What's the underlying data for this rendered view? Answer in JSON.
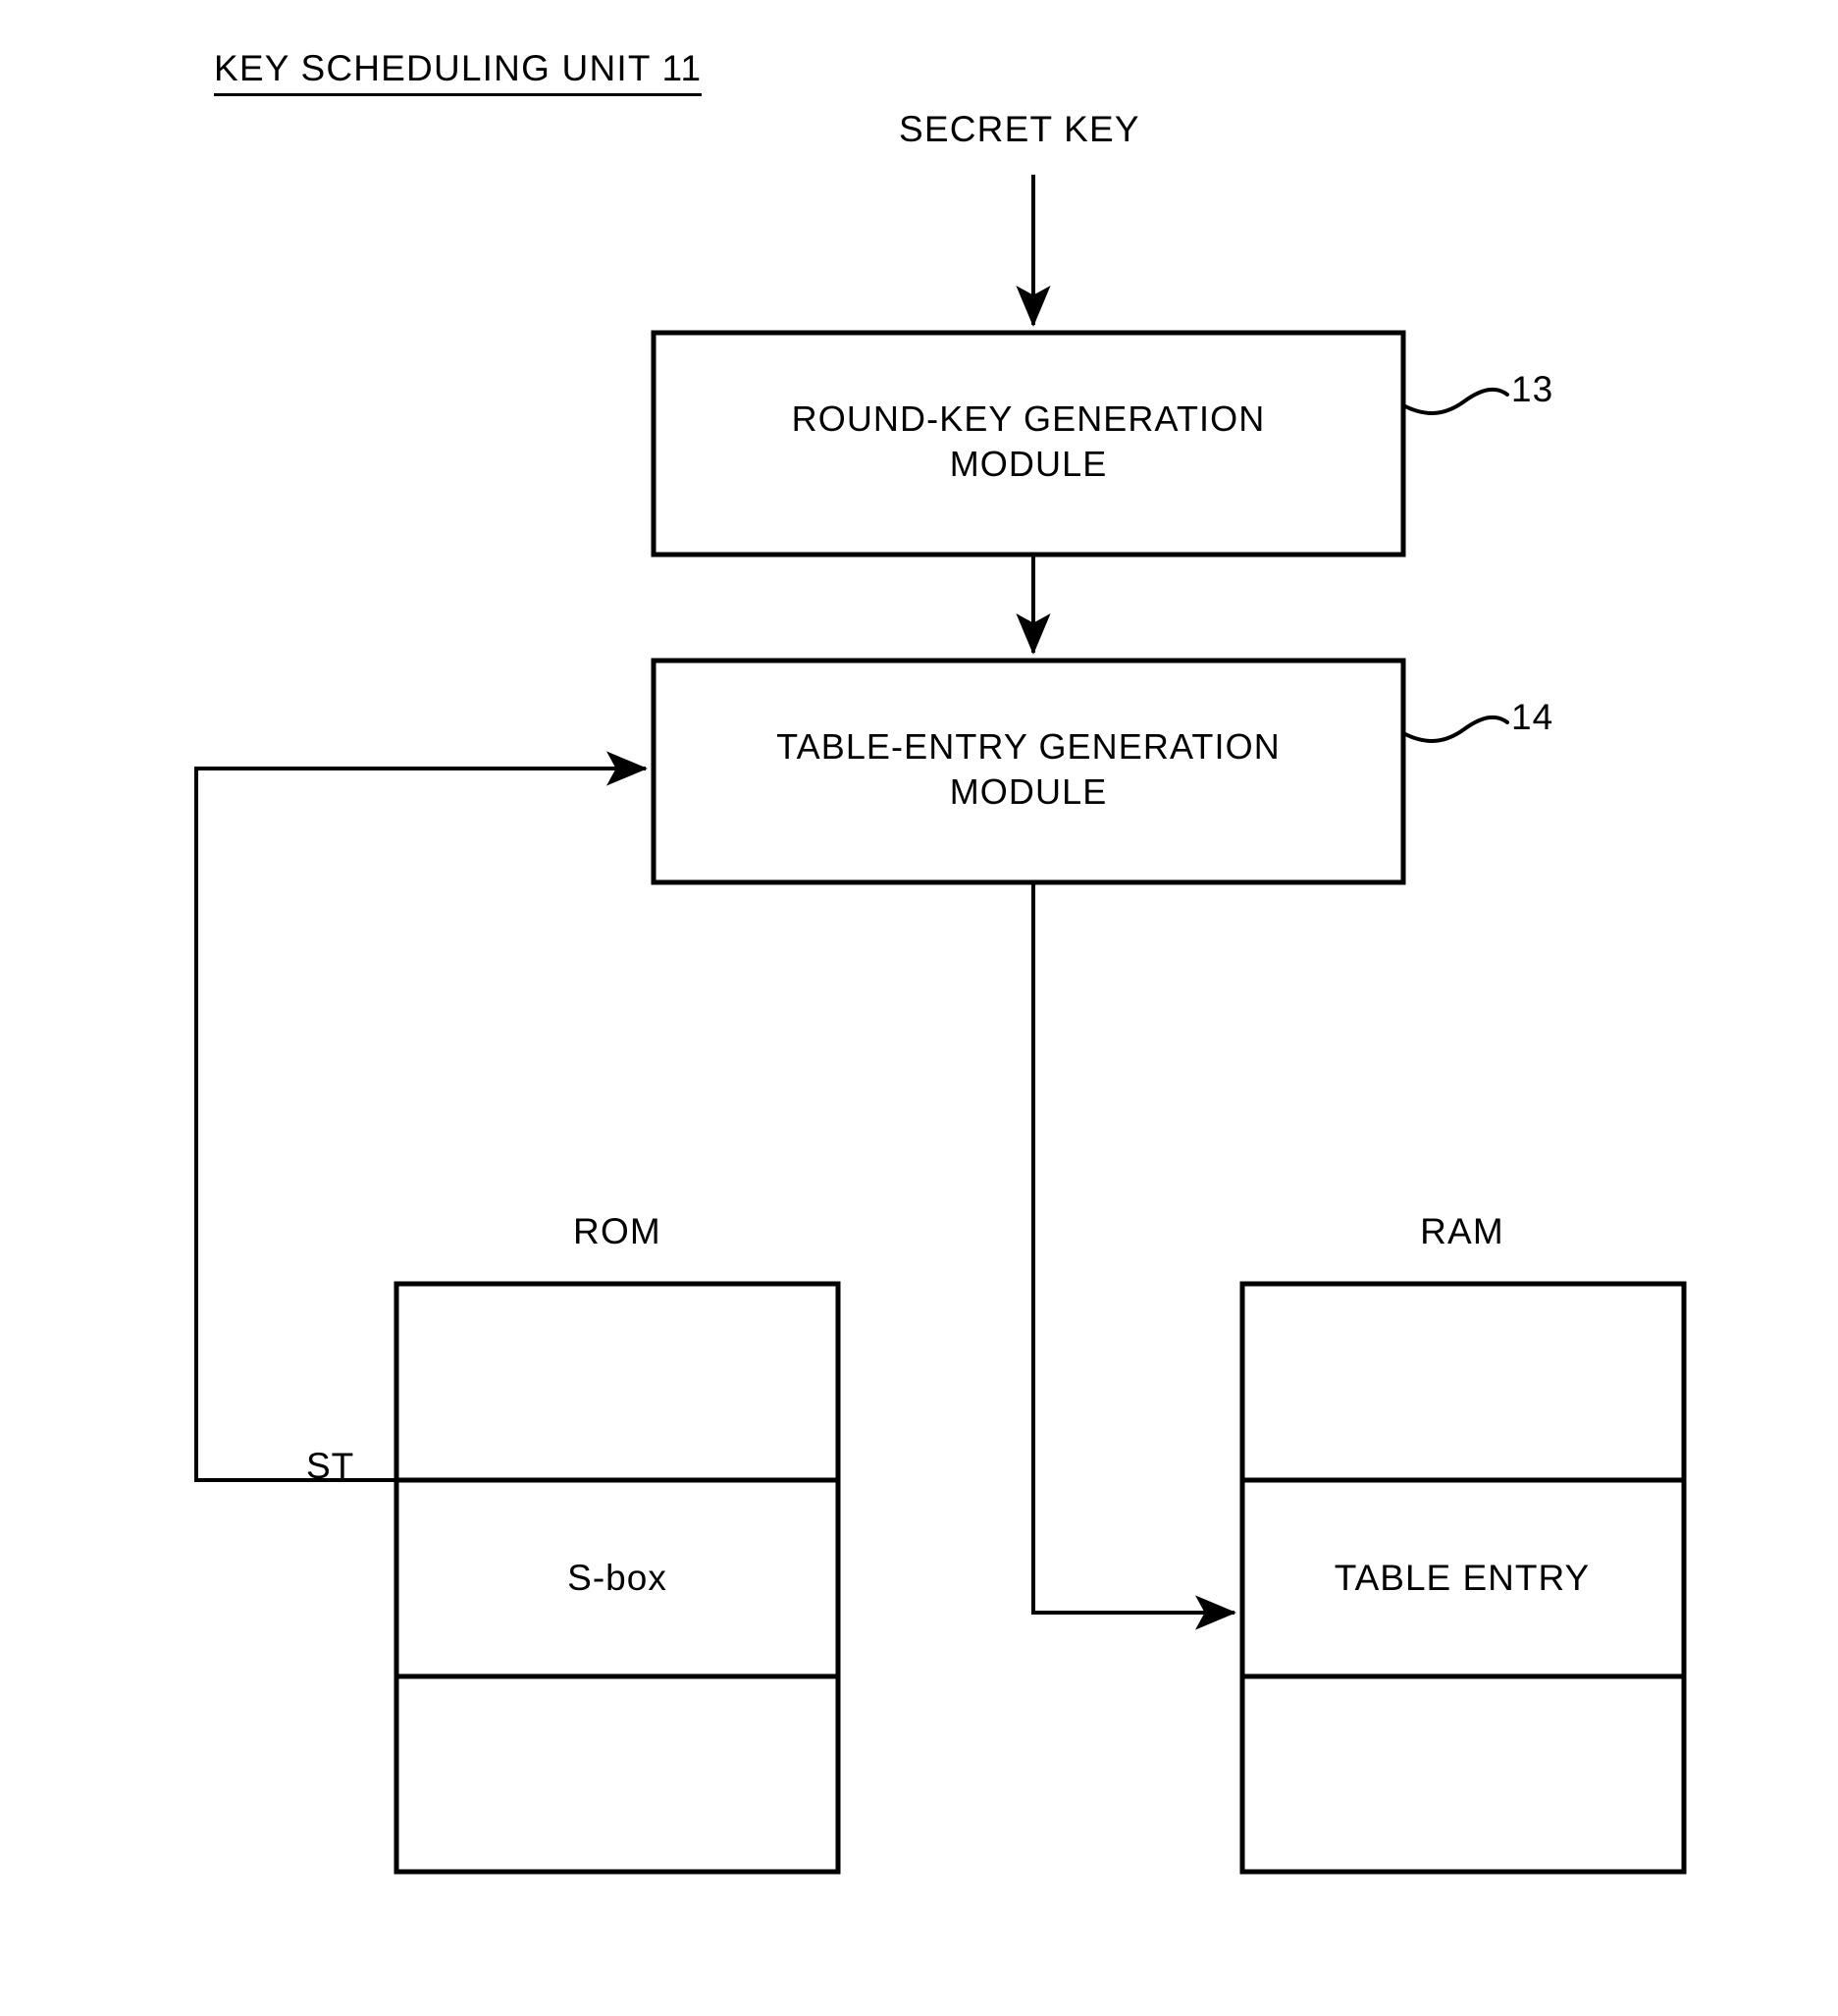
{
  "figure": {
    "title": "KEY SCHEDULING UNIT 11",
    "background_color": "#ffffff",
    "line_color": "#000000"
  },
  "labels": {
    "secret_key": "SECRET KEY",
    "st": "ST",
    "rom": "ROM",
    "ram": "RAM",
    "sbox": "S-box",
    "table_entry": "TABLE ENTRY"
  },
  "modules": [
    {
      "id": "round-key-generation-module",
      "label": "ROUND-KEY GENERATION\nMODULE",
      "ref": "13"
    },
    {
      "id": "table-entry-generation-module",
      "label": "TABLE-ENTRY GENERATION\nMODULE",
      "ref": "14"
    }
  ],
  "memory_blocks": [
    {
      "id": "rom",
      "title": "ROM",
      "cells": [
        "",
        "S-box",
        ""
      ]
    },
    {
      "id": "ram",
      "title": "RAM",
      "cells": [
        "",
        "TABLE ENTRY",
        ""
      ]
    }
  ],
  "connections": [
    {
      "id": "secret-key-to-round-key",
      "from": "SECRET KEY",
      "to": "ROUND-KEY GENERATION MODULE"
    },
    {
      "id": "round-key-to-table-entry",
      "from": "ROUND-KEY GENERATION MODULE",
      "to": "TABLE-ENTRY GENERATION MODULE"
    },
    {
      "id": "st-to-table-entry",
      "from": "ST",
      "to": "TABLE-ENTRY GENERATION MODULE"
    },
    {
      "id": "table-entry-to-ram",
      "from": "TABLE-ENTRY GENERATION MODULE",
      "to": "TABLE ENTRY"
    }
  ]
}
